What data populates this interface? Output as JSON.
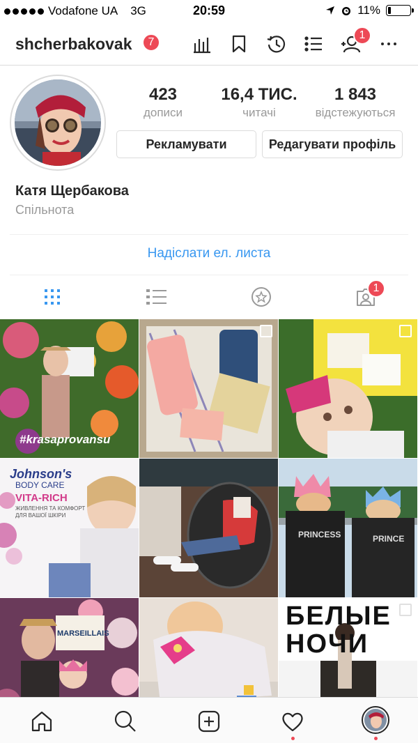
{
  "status_bar": {
    "carrier": "Vodafone UA",
    "network": "3G",
    "time": "20:59",
    "battery": "11%",
    "battery_level": 0.11
  },
  "header": {
    "username": "shcherbakovak",
    "notification_count": "7",
    "follow_requests_count": "1",
    "icons": [
      "insights-icon",
      "bookmark-icon",
      "archive-icon",
      "list-icon",
      "discover-people-icon",
      "more-icon"
    ]
  },
  "profile": {
    "stats": [
      {
        "value": "423",
        "label": "дописи"
      },
      {
        "value": "16,4 ТИС.",
        "label": "читачі"
      },
      {
        "value": "1 843",
        "label": "відстежуються"
      }
    ],
    "promote_button": "Рекламувати",
    "edit_button": "Редагувати профіль",
    "full_name": "Катя Щербакова",
    "category": "Спільнота",
    "email_link": "Надіслати ел. листа"
  },
  "tabs": {
    "items": [
      "grid-icon",
      "list-view-icon",
      "saved-star-icon",
      "tagged-icon"
    ],
    "active": "grid-icon",
    "tagged_badge": "1",
    "active_color": "#3897f0"
  },
  "grid": {
    "tile_1_text": "#krasaprovansu",
    "tile_4_brand": "Johnson's",
    "tile_4_sub": "BODY CARE",
    "tile_4_line": "VITA-RICH",
    "tile_4_line2": "ЖИВЛЕННЯ ТА КОМФОРТ",
    "tile_4_line3": "ДЛЯ ВАШОЇ ШКІРИ",
    "tile_6_shirt1": "PRINCESS",
    "tile_6_shirt2": "PRINCE",
    "tile_7_sign": "MARSEILLAIS",
    "tile_9_sign": "БЕЛЫЕ НОЧИ"
  },
  "bottom_nav": {
    "items": [
      "home-icon",
      "search-icon",
      "new-post-icon",
      "activity-heart-icon",
      "profile-avatar"
    ]
  },
  "colors": {
    "badge": "#ed4956",
    "link": "#3897f0",
    "muted": "#999999",
    "border": "#dbdbdb"
  }
}
